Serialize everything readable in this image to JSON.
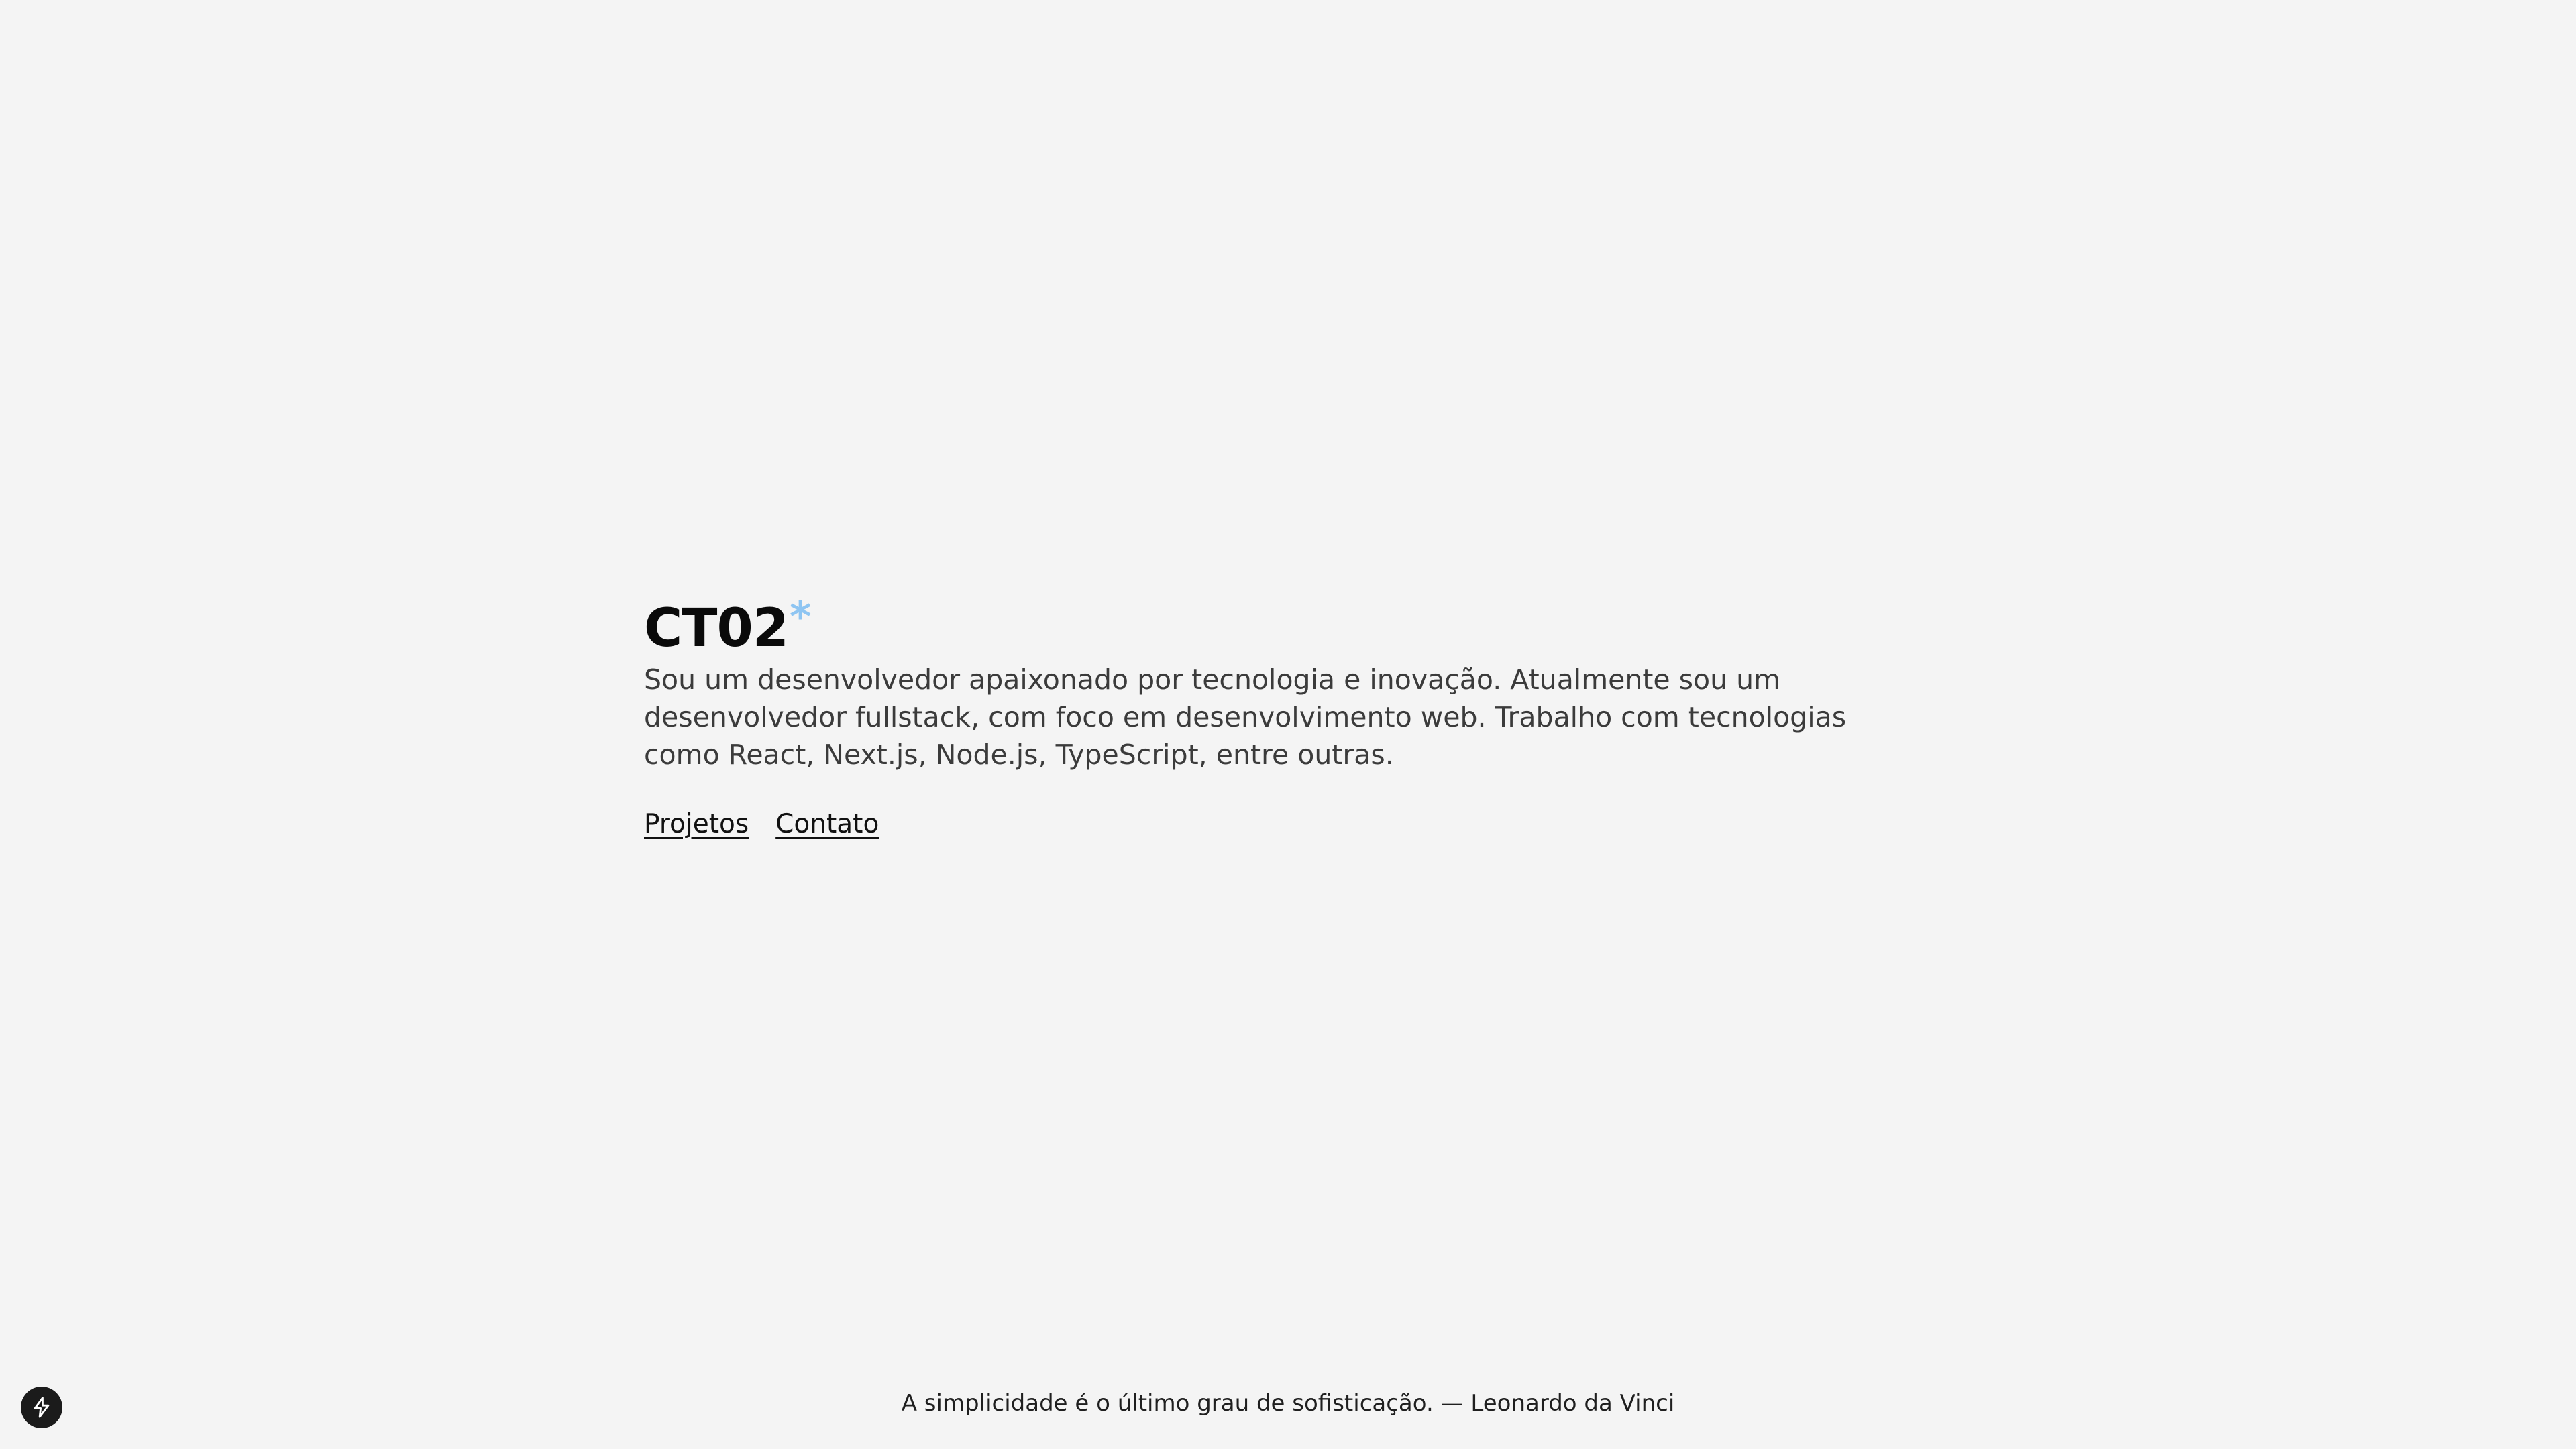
{
  "hero": {
    "title": "CT02",
    "title_mark": "*",
    "bio": "Sou um desenvolvedor apaixonado por tecnologia e inovação. Atualmente sou um desenvolvedor fullstack, com foco em desenvolvimento web. Trabalho com tecnologias como React, Next.js, Node.js, TypeScript, entre outras.",
    "links": [
      {
        "label": "Projetos"
      },
      {
        "label": "Contato"
      }
    ]
  },
  "footer": {
    "quote": "A simplicidade é o último grau de sofisticação. — Leonardo da Vinci"
  },
  "floating_button": {
    "icon": "lightning-icon"
  },
  "colors": {
    "background": "#f4f4f4",
    "accent": "#8ec5f2",
    "text": "#111111"
  }
}
